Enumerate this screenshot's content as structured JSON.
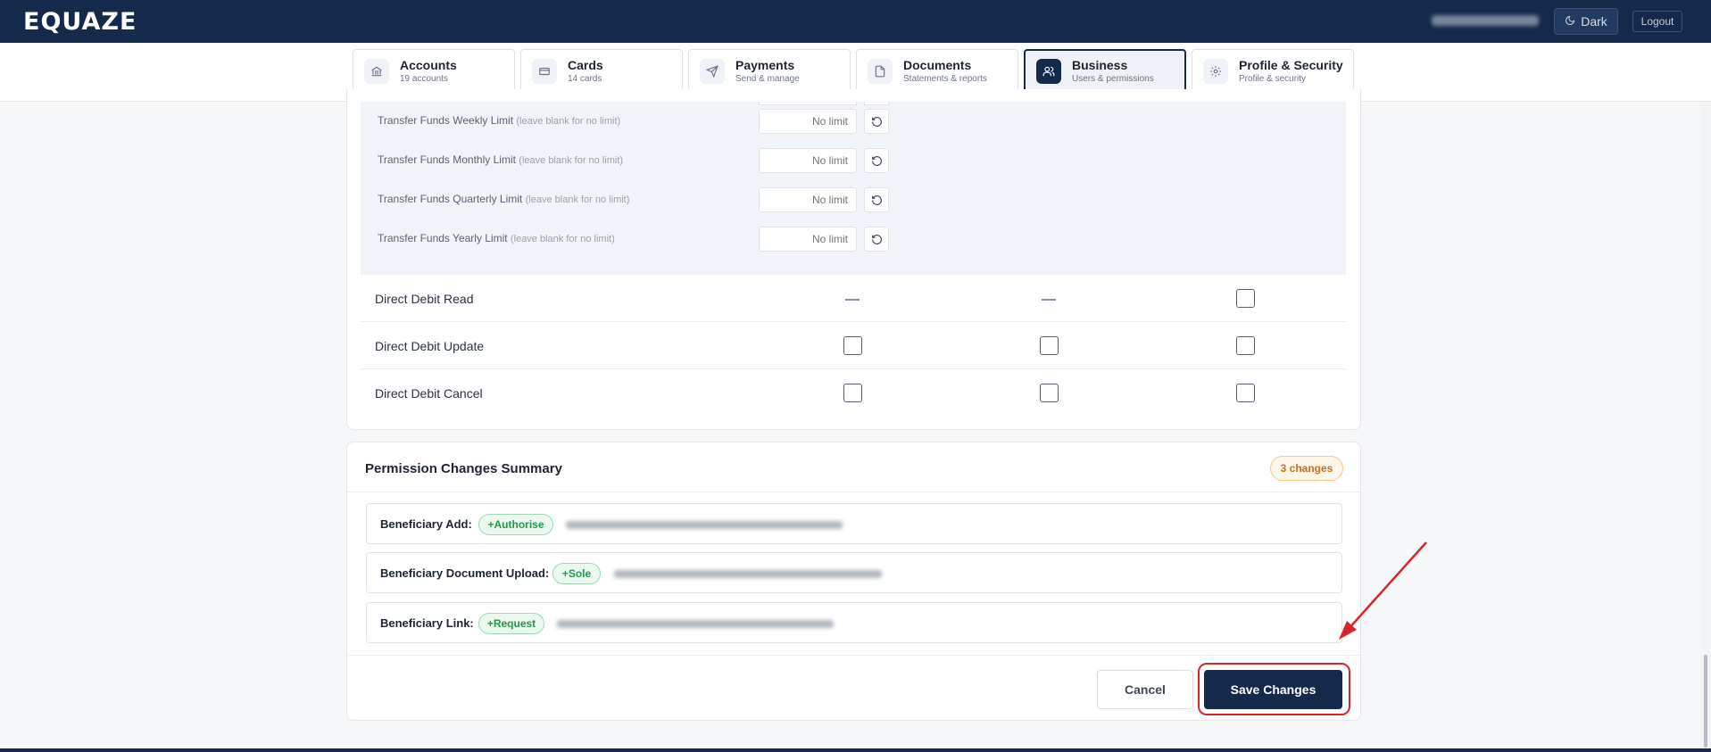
{
  "app": {
    "brand": "EQUAZE"
  },
  "header": {
    "theme_button": "Dark",
    "logout_button": "Logout"
  },
  "nav": {
    "tabs": [
      {
        "label": "Accounts",
        "sub": "19 accounts",
        "icon": "bank-icon",
        "active": false
      },
      {
        "label": "Cards",
        "sub": "14 cards",
        "icon": "credit-card-icon",
        "active": false
      },
      {
        "label": "Payments",
        "sub": "Send & manage",
        "icon": "send-icon",
        "active": false
      },
      {
        "label": "Documents",
        "sub": "Statements & reports",
        "icon": "document-icon",
        "active": false
      },
      {
        "label": "Business",
        "sub": "Users & permissions",
        "icon": "users-icon",
        "active": true
      },
      {
        "label": "Profile & Security",
        "sub": "Profile & security",
        "icon": "gear-icon",
        "active": false
      }
    ]
  },
  "limits": {
    "hint": "(leave blank for no limit)",
    "placeholder": "No limit",
    "rows": [
      {
        "label": "Transfer Funds Weekly Limit"
      },
      {
        "label": "Transfer Funds Monthly Limit"
      },
      {
        "label": "Transfer Funds Quarterly Limit"
      },
      {
        "label": "Transfer Funds Yearly Limit"
      }
    ]
  },
  "permissions": {
    "rows": [
      {
        "label": "Direct Debit Read",
        "cells": [
          "dash",
          "dash",
          "checkbox"
        ]
      },
      {
        "label": "Direct Debit Update",
        "cells": [
          "checkbox",
          "checkbox",
          "checkbox"
        ]
      },
      {
        "label": "Direct Debit Cancel",
        "cells": [
          "checkbox",
          "checkbox",
          "checkbox"
        ]
      }
    ]
  },
  "summary": {
    "title": "Permission Changes Summary",
    "badge": "3 changes",
    "items": [
      {
        "label": "Beneficiary Add:",
        "change": "+Authorise"
      },
      {
        "label": "Beneficiary Document Upload:",
        "change": "+Sole"
      },
      {
        "label": "Beneficiary Link:",
        "change": "+Request"
      }
    ],
    "cancel_button": "Cancel",
    "save_button": "Save Changes"
  },
  "colors": {
    "navy": "#15294b",
    "accent_highlight": "#d8252a",
    "success_green": "#1f9a4e",
    "warning_orange": "#c9701d"
  }
}
